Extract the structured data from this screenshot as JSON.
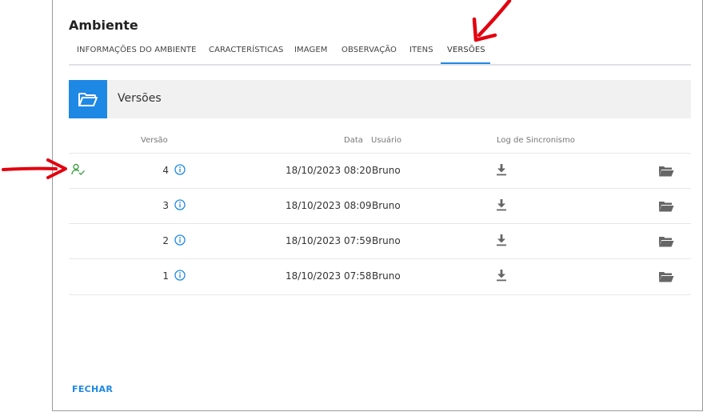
{
  "dialog": {
    "title": "Ambiente",
    "tabs": [
      {
        "label": "INFORMAÇÕES DO AMBIENTE",
        "active": false
      },
      {
        "label": "CARACTERÍSTICAS",
        "active": false
      },
      {
        "label": "IMAGEM",
        "active": false
      },
      {
        "label": "OBSERVAÇÃO",
        "active": false
      },
      {
        "label": "ITENS",
        "active": false
      },
      {
        "label": "VERSÕES",
        "active": true
      }
    ],
    "panel": {
      "title": "Versões",
      "icon": "folder-open-icon"
    },
    "table": {
      "headers": {
        "versao": "Versão",
        "data": "Data",
        "usuario": "Usuário",
        "log": "Log de Sincronismo"
      },
      "rows": [
        {
          "versao": "4",
          "data": "18/10/2023 08:20",
          "usuario": "Bruno",
          "synced": true
        },
        {
          "versao": "3",
          "data": "18/10/2023 08:09",
          "usuario": "Bruno",
          "synced": false
        },
        {
          "versao": "2",
          "data": "18/10/2023 07:59",
          "usuario": "Bruno",
          "synced": false
        },
        {
          "versao": "1",
          "data": "18/10/2023 07:58",
          "usuario": "Bruno",
          "synced": false
        }
      ]
    },
    "footer": {
      "close_label": "FECHAR"
    }
  },
  "colors": {
    "accent": "#1e88e5",
    "synced": "#43a047",
    "annotation": "#e3000f"
  }
}
